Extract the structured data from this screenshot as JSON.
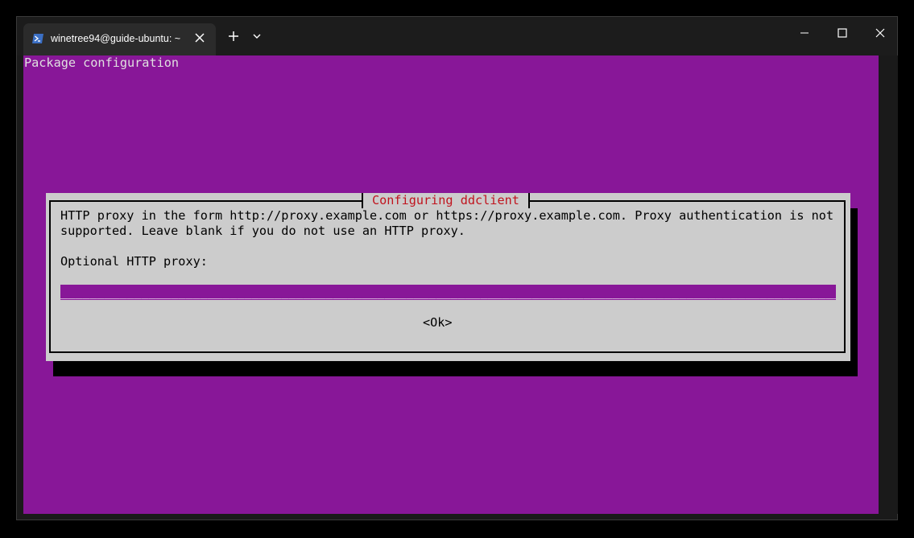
{
  "window": {
    "tab_title": "winetree94@guide-ubuntu: ~",
    "tab_icon": "powershell-prompt-icon",
    "new_tab_icon": "plus-icon",
    "dropdown_icon": "chevron-down-icon",
    "controls": [
      "minimize-icon",
      "maximize-icon",
      "close-icon"
    ]
  },
  "terminal": {
    "background_color": "#881798",
    "backtitle": "Package configuration"
  },
  "dialog": {
    "title": "Configuring ddclient",
    "title_color": "#c0141e",
    "body_line_1": "HTTP proxy in the form http://proxy.example.com or https://proxy.example.com. Proxy authentication is not",
    "body_line_2": "supported. Leave blank if you do not use an HTTP proxy.",
    "prompt": "Optional HTTP proxy:",
    "input_value": "",
    "ok_label": "<Ok>"
  }
}
